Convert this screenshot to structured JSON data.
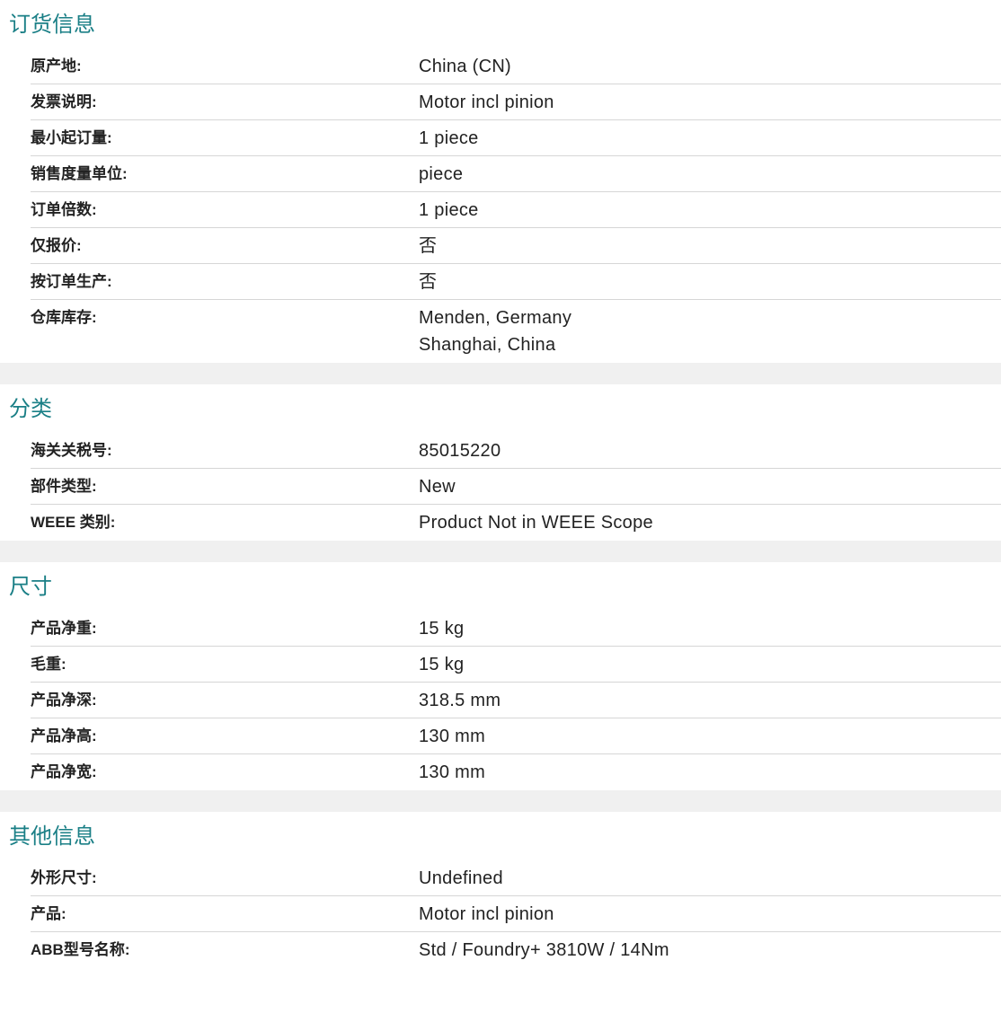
{
  "sections": [
    {
      "title": "订货信息",
      "rows": [
        {
          "label": "原产地:",
          "value": "China (CN)"
        },
        {
          "label": "发票说明:",
          "value": "Motor incl pinion"
        },
        {
          "label": "最小起订量:",
          "value": "1 piece"
        },
        {
          "label": "销售度量单位:",
          "value": "piece"
        },
        {
          "label": "订单倍数:",
          "value": "1 piece"
        },
        {
          "label": "仅报价:",
          "value": "否"
        },
        {
          "label": "按订单生产:",
          "value": "否"
        },
        {
          "label": "仓库库存:",
          "value_lines": [
            "Menden, Germany",
            "Shanghai, China"
          ]
        }
      ]
    },
    {
      "title": "分类",
      "rows": [
        {
          "label": "海关关税号:",
          "value": "85015220"
        },
        {
          "label": "部件类型:",
          "value": "New"
        },
        {
          "label": "WEEE 类别:",
          "value": "Product Not in WEEE Scope"
        }
      ]
    },
    {
      "title": "尺寸",
      "rows": [
        {
          "label": "产品净重:",
          "value": "15 kg"
        },
        {
          "label": "毛重:",
          "value": "15 kg"
        },
        {
          "label": "产品净深:",
          "value": "318.5 mm"
        },
        {
          "label": "产品净高:",
          "value": "130 mm"
        },
        {
          "label": "产品净宽:",
          "value": "130 mm"
        }
      ]
    },
    {
      "title": "其他信息",
      "rows": [
        {
          "label": "外形尺寸:",
          "value": "Undefined"
        },
        {
          "label": "产品:",
          "value": "Motor incl pinion"
        },
        {
          "label": "ABB型号名称:",
          "value": "Std / Foundry+ 3810W / 14Nm"
        }
      ]
    }
  ],
  "colors": {
    "section_title": "#1a7f86",
    "gap_background": "#f0f0f0",
    "row_divider": "#d6d6d6"
  }
}
